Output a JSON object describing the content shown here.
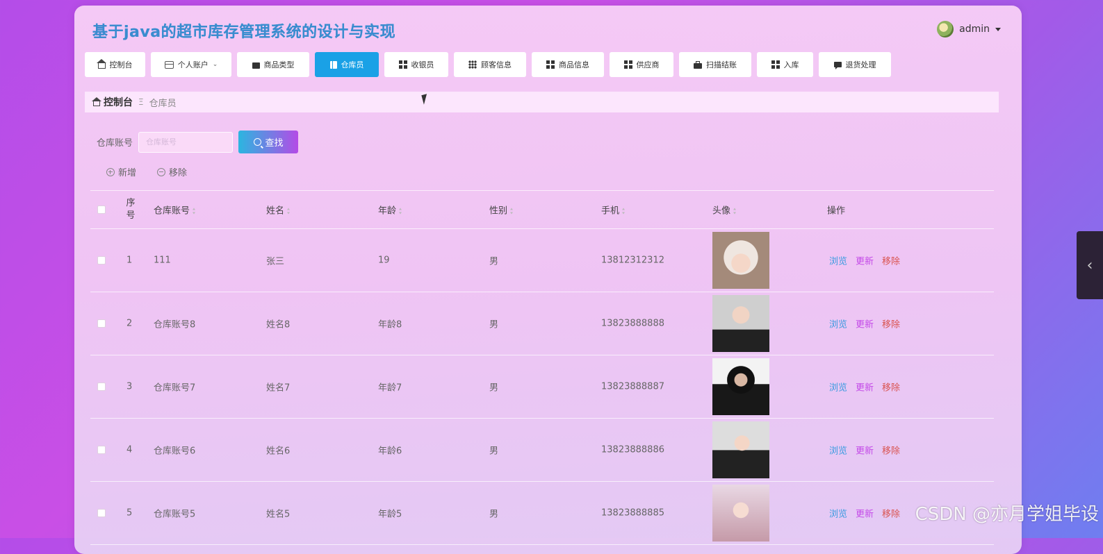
{
  "header": {
    "title": "基于java的超市库存管理系统的设计与实现",
    "user": "admin"
  },
  "nav": [
    {
      "label": "控制台",
      "icon": "home-icon"
    },
    {
      "label": "个人账户",
      "icon": "card-icon"
    },
    {
      "label": "商品类型",
      "icon": "wallet-icon"
    },
    {
      "label": "仓库员",
      "icon": "book-icon"
    },
    {
      "label": "收银员",
      "icon": "grid-icon"
    },
    {
      "label": "顾客信息",
      "icon": "grid9-icon"
    },
    {
      "label": "商品信息",
      "icon": "grid-icon"
    },
    {
      "label": "供应商",
      "icon": "grid-icon"
    },
    {
      "label": "扫描结账",
      "icon": "briefcase-icon"
    },
    {
      "label": "入库",
      "icon": "grid-icon"
    },
    {
      "label": "退货处理",
      "icon": "chat-icon"
    }
  ],
  "breadcrumb": {
    "home": "控制台",
    "separator": "Ξ",
    "current": "仓库员"
  },
  "search": {
    "label": "仓库账号",
    "placeholder": "仓库账号",
    "button": "查找"
  },
  "actions": {
    "add": "新增",
    "remove": "移除"
  },
  "table": {
    "headers": [
      "序号",
      "仓库账号",
      "姓名",
      "年龄",
      "性别",
      "手机",
      "头像",
      "操作"
    ],
    "rows": [
      {
        "no": "1",
        "account": "111",
        "name": "张三",
        "age": "19",
        "gender": "男",
        "phone": "13812312312"
      },
      {
        "no": "2",
        "account": "仓库账号8",
        "name": "姓名8",
        "age": "年龄8",
        "gender": "男",
        "phone": "13823888888"
      },
      {
        "no": "3",
        "account": "仓库账号7",
        "name": "姓名7",
        "age": "年龄7",
        "gender": "男",
        "phone": "13823888887"
      },
      {
        "no": "4",
        "account": "仓库账号6",
        "name": "姓名6",
        "age": "年龄6",
        "gender": "男",
        "phone": "13823888886"
      },
      {
        "no": "5",
        "account": "仓库账号5",
        "name": "姓名5",
        "age": "年龄5",
        "gender": "男",
        "phone": "13823888885"
      }
    ],
    "ops": {
      "view": "浏览",
      "edit": "更新",
      "delete": "移除"
    }
  },
  "watermark": "CSDN @亦月学姐毕设",
  "colors": {
    "active_tab": "#1aa1e6",
    "view": "#3a9be0",
    "edit": "#c44be8",
    "delete": "#d9534f"
  }
}
